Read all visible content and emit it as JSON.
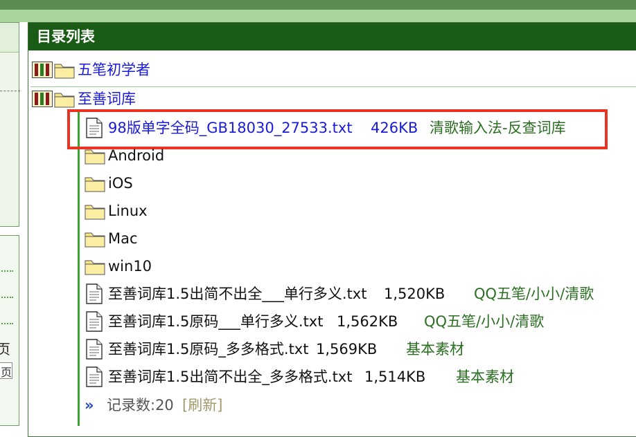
{
  "panel": {
    "title": "目录列表"
  },
  "left": {
    "page_char": "页",
    "page_box_char": "页"
  },
  "tree": {
    "top_folders": [
      {
        "label": "五笔初学者"
      },
      {
        "label": "至善词库"
      }
    ],
    "items": [
      {
        "type": "file",
        "name": "98版单字全码_GB18030_27533.txt",
        "size": "426KB",
        "tag": "清歌输入法-反查词库",
        "highlighted": true
      },
      {
        "type": "folder",
        "name": "Android"
      },
      {
        "type": "folder",
        "name": "iOS"
      },
      {
        "type": "folder",
        "name": "Linux"
      },
      {
        "type": "folder",
        "name": "Mac"
      },
      {
        "type": "folder",
        "name": "win10"
      },
      {
        "type": "file",
        "name": "至善词库1.5出简不出全___单行多义.txt",
        "size": "1,520KB",
        "tag": "QQ五笔/小小/清歌"
      },
      {
        "type": "file",
        "name": "至善词库1.5原码___单行多义.txt",
        "size": "1,562KB",
        "tag": "QQ五笔/小小/清歌"
      },
      {
        "type": "file",
        "name": "至善词库1.5原码_多多格式.txt",
        "size": "1,569KB",
        "tag": "基本素材"
      },
      {
        "type": "file",
        "name": "至善词库1.5出简不出全_多多格式.txt",
        "size": "1,514KB",
        "tag": "基本素材"
      }
    ]
  },
  "footer": {
    "arrow": "»",
    "count_label": "记录数:20",
    "refresh_label": "[刷新]"
  },
  "colors": {
    "header_bg": "#1a5b15",
    "link": "#1a1adb",
    "tag": "#2b6e22",
    "highlight": "#ea3323"
  }
}
